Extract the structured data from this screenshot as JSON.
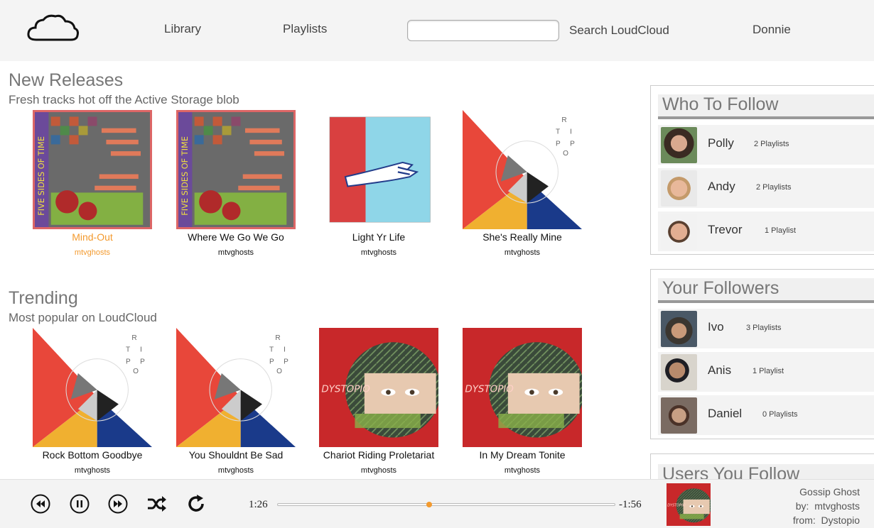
{
  "header": {
    "nav": {
      "library": "Library",
      "playlists": "Playlists"
    },
    "search": {
      "placeholder": "",
      "label": "Search LoudCloud"
    },
    "user": "Donnie"
  },
  "new_releases": {
    "title": "New Releases",
    "subtitle": "Fresh tracks hot off the Active Storage blob",
    "items": [
      {
        "title": "Mind-Out",
        "artist": "mtvghosts",
        "art": "five-sides",
        "active": true
      },
      {
        "title": "Where We Go We Go",
        "artist": "mtvghosts",
        "art": "five-sides"
      },
      {
        "title": "Light Yr Life",
        "artist": "mtvghosts",
        "art": "hand"
      },
      {
        "title": "She's Really Mine",
        "artist": "mtvghosts",
        "art": "trio"
      }
    ]
  },
  "trending": {
    "title": "Trending",
    "subtitle": "Most popular on LoudCloud",
    "items": [
      {
        "title": "Rock Bottom Goodbye",
        "artist": "mtvghosts",
        "art": "trio"
      },
      {
        "title": "You Shouldnt Be Sad",
        "artist": "mtvghosts",
        "art": "trio"
      },
      {
        "title": "Chariot Riding Proletariat",
        "artist": "mtvghosts",
        "art": "dystopio"
      },
      {
        "title": "In My Dream Tonite",
        "artist": "mtvghosts",
        "art": "dystopio"
      }
    ]
  },
  "who_to_follow": {
    "title": "Who To Follow",
    "people": [
      {
        "name": "Polly",
        "count": "2 Playlists"
      },
      {
        "name": "Andy",
        "count": "2 Playlists"
      },
      {
        "name": "Trevor",
        "count": "1 Playlist"
      }
    ]
  },
  "your_followers": {
    "title": "Your Followers",
    "people": [
      {
        "name": "Ivo",
        "count": "3 Playlists"
      },
      {
        "name": "Anis",
        "count": "1 Playlist"
      },
      {
        "name": "Daniel",
        "count": "0 Playlists"
      }
    ]
  },
  "users_you_follow": {
    "title": "Users You Follow"
  },
  "player": {
    "elapsed": "1:26",
    "remaining": "-1:56",
    "progress": 0.45,
    "track": "Gossip Ghost",
    "by_label": "by:",
    "artist": "mtvghosts",
    "from_label": "from:",
    "album": "Dystopio"
  },
  "colors": {
    "accent": "#f39a2e",
    "header_bg": "#f4f4f4",
    "selected_border": "#d66666"
  }
}
